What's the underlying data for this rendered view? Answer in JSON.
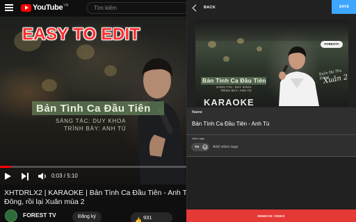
{
  "overlay": {
    "headline": "EASY TO EDIT",
    "headline_color": "#ff2d2d"
  },
  "youtube": {
    "logo_text": "YouTube",
    "logo_superscript": "VN",
    "search_placeholder": "Tìm kiếm",
    "video": {
      "on_screen_song": "Bản Tình Ca Đầu Tiên",
      "on_screen_credit_1": "SÁNG TÁC: DUY KHOA",
      "on_screen_credit_2": "TRÌNH BÀY: ANH TÚ",
      "progress_fraction": 0.06,
      "time": "0:03 / 5:10"
    },
    "title_line_1": "XHTDRLX2 | KARAOKE | Bản Tình Ca Đầu Tiên - Anh Tú tại Xuân",
    "title_line_2": "Đông, rồi lại Xuân mùa 2",
    "channel_name": "FOREST TV",
    "subscribe_label": "Đăng ký",
    "like_count": "931",
    "colors": {
      "brand_red": "#ff0000",
      "background": "#0f0f0f"
    }
  },
  "editor": {
    "back_label": "BACK",
    "save_label": "SAVE",
    "thumbnail": {
      "logo": "FORESTV",
      "song_text": "Bản Tình Ca Đầu Tiên",
      "credit_1": "SÁNG TÁC: DUY KHOA",
      "credit_2": "TRÌNH BÀY: ANH TÚ",
      "script_small": "Xuân Hạ Thu Đông",
      "script_big": "Xuân 2",
      "karaoke_text": "KARAOKE"
    },
    "name_label": "Name",
    "name_value": "Bản Tình Ca Đầu Tiên - Anh Tú",
    "tags_label": "Video tags",
    "tags": [
      "TH"
    ],
    "tags_placeholder": "Add video tags",
    "remove_label": "REMOVE VIDEO",
    "colors": {
      "save": "#3ea6ff",
      "remove": "#e53935",
      "panel": "#212121"
    }
  }
}
